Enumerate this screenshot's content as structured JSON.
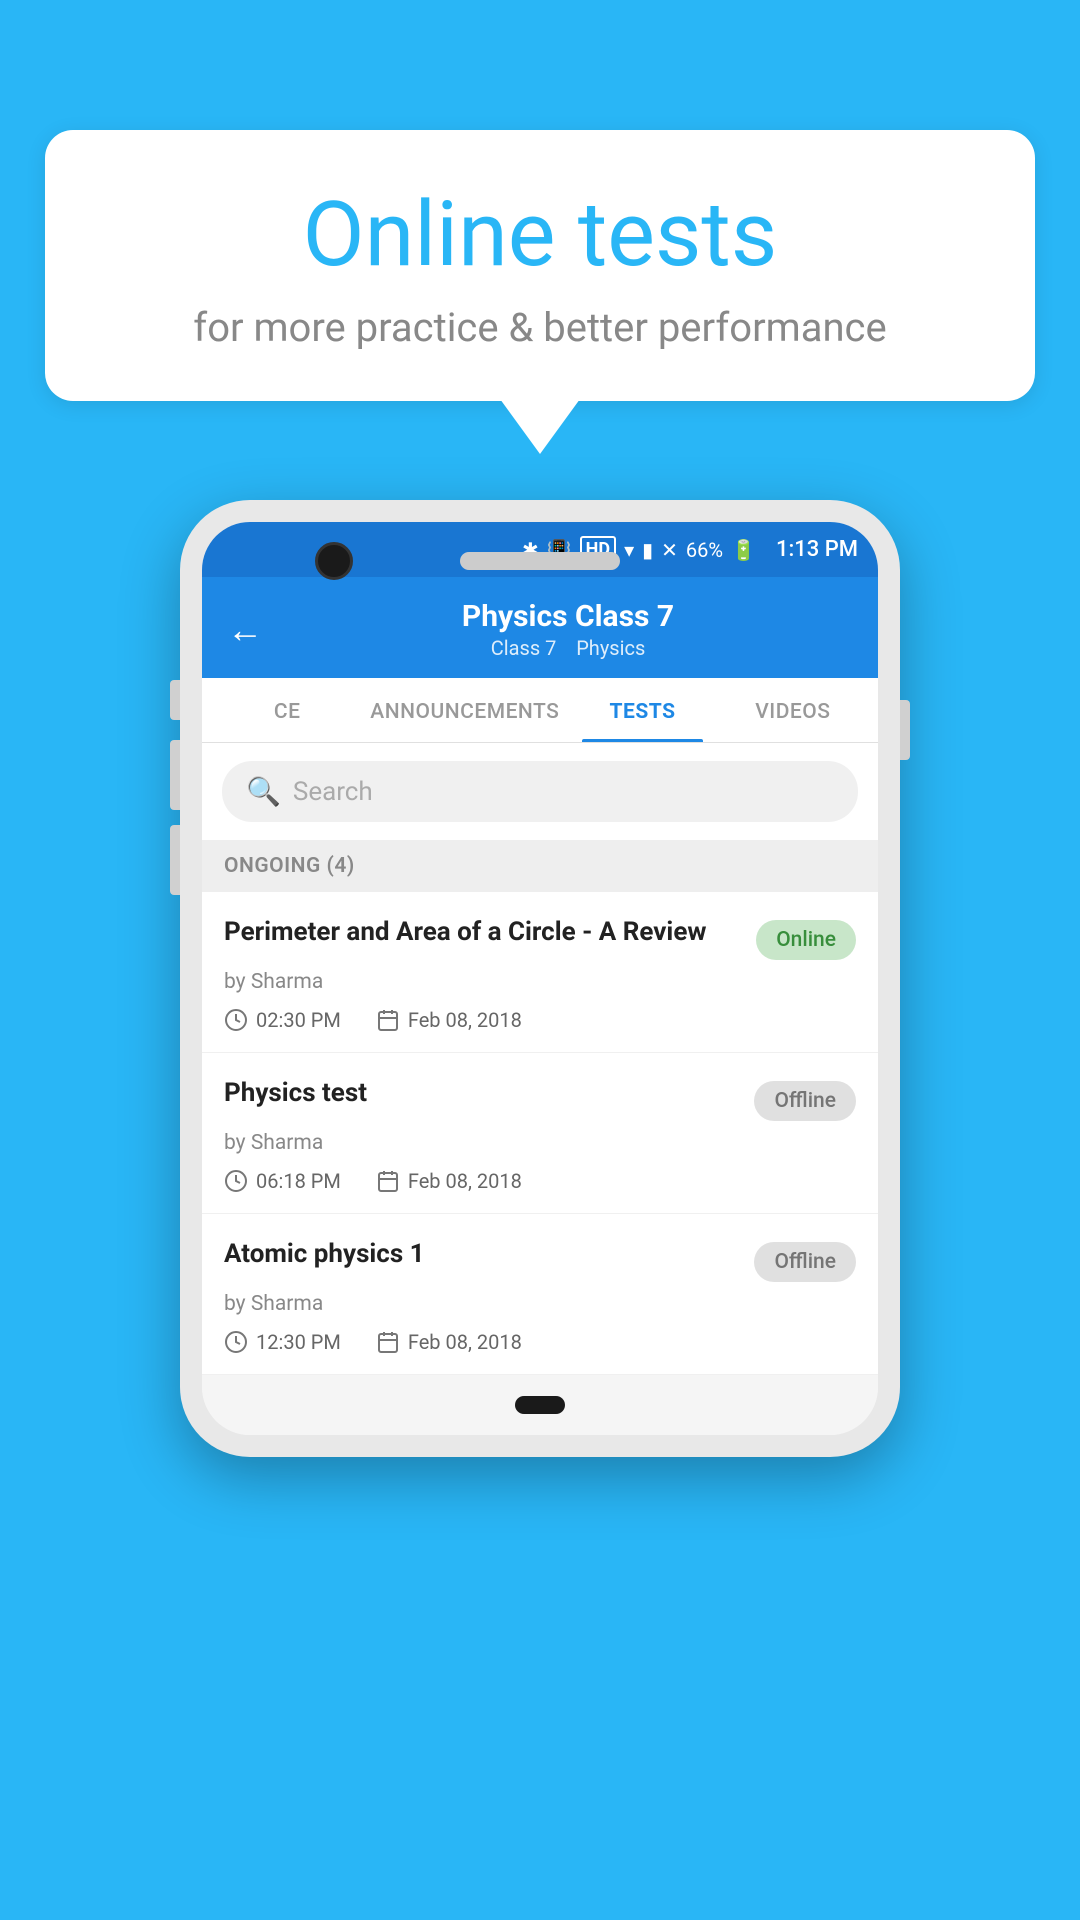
{
  "background_color": "#29B6F6",
  "speech_bubble": {
    "title": "Online tests",
    "subtitle": "for more practice & better performance"
  },
  "status_bar": {
    "battery": "66%",
    "time": "1:13 PM"
  },
  "app_bar": {
    "title": "Physics Class 7",
    "subtitle_class": "Class 7",
    "subtitle_subject": "Physics",
    "back_label": "←"
  },
  "tabs": [
    {
      "label": "CE",
      "active": false
    },
    {
      "label": "ANNOUNCEMENTS",
      "active": false
    },
    {
      "label": "TESTS",
      "active": true
    },
    {
      "label": "VIDEOS",
      "active": false
    }
  ],
  "search": {
    "placeholder": "Search"
  },
  "section": {
    "label": "ONGOING (4)"
  },
  "tests": [
    {
      "title": "Perimeter and Area of a Circle - A Review",
      "status": "Online",
      "status_type": "online",
      "author": "by Sharma",
      "time": "02:30 PM",
      "date": "Feb 08, 2018"
    },
    {
      "title": "Physics test",
      "status": "Offline",
      "status_type": "offline",
      "author": "by Sharma",
      "time": "06:18 PM",
      "date": "Feb 08, 2018"
    },
    {
      "title": "Atomic physics 1",
      "status": "Offline",
      "status_type": "offline",
      "author": "by Sharma",
      "time": "12:30 PM",
      "date": "Feb 08, 2018"
    }
  ]
}
